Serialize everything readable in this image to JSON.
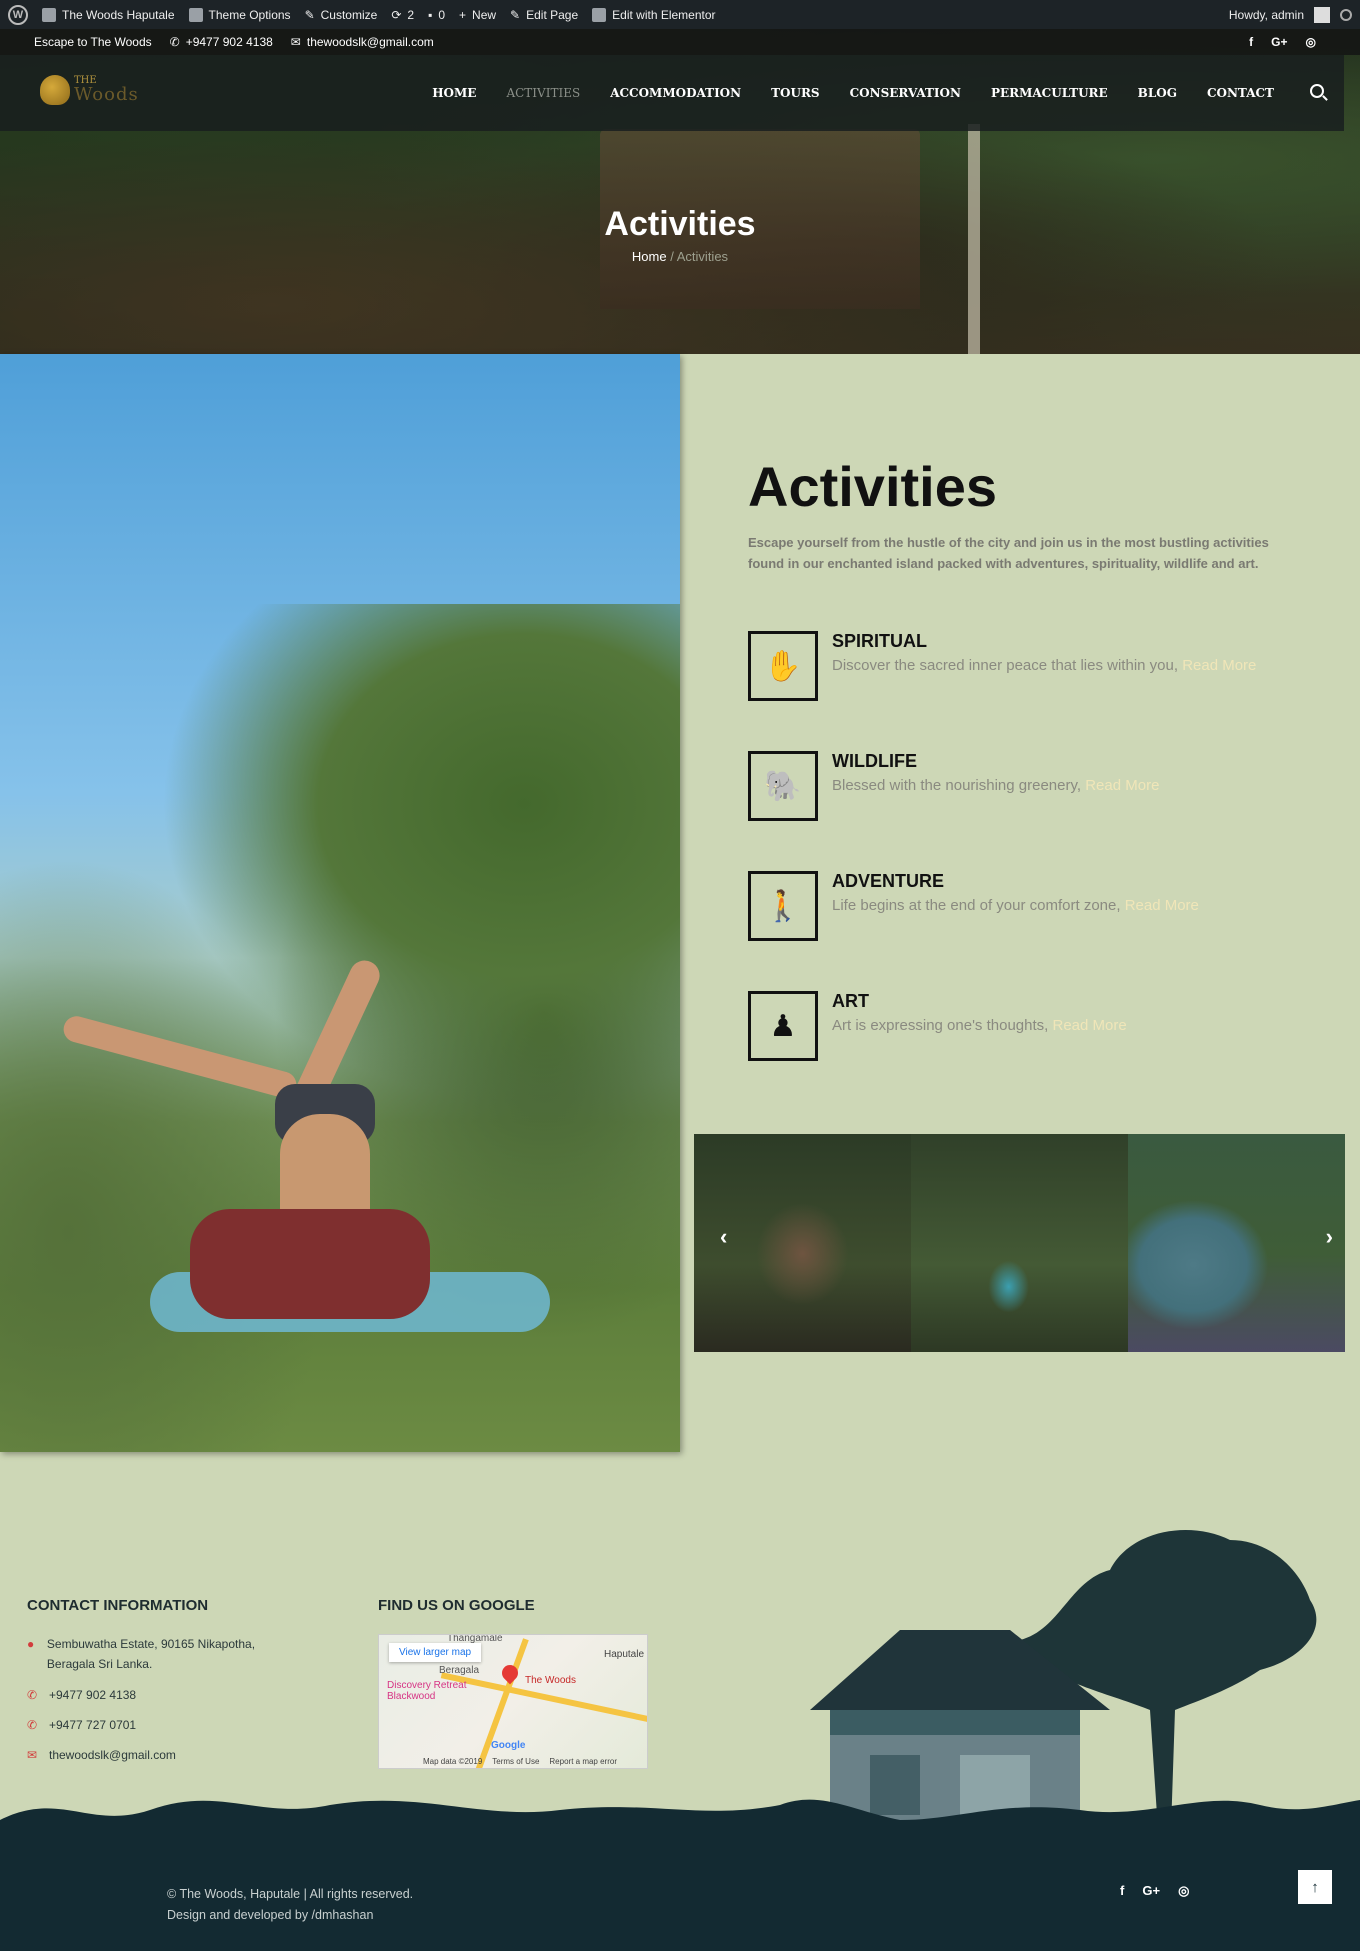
{
  "admin_bar": {
    "site_name": "The Woods Haputale",
    "theme_options": "Theme Options",
    "customize": "Customize",
    "updates_count": "2",
    "comments_count": "0",
    "new_label": "New",
    "edit_page": "Edit Page",
    "edit_elementor": "Edit with Elementor",
    "howdy": "Howdy, admin"
  },
  "top_info": {
    "tagline": "Escape to The Woods",
    "phone": "+9477 902 4138",
    "email": "thewoodslk@gmail.com",
    "social": [
      "f",
      "G+",
      "◎"
    ]
  },
  "logo": {
    "line1": "THE",
    "line2": "Woods"
  },
  "nav": {
    "items": [
      "HOME",
      "ACTIVITIES",
      "ACCOMMODATION",
      "TOURS",
      "CONSERVATION",
      "PERMACULTURE",
      "BLOG",
      "CONTACT"
    ],
    "active": "ACTIVITIES"
  },
  "hero": {
    "title": "Activities",
    "crumb_home": "Home",
    "crumb_sep": "/",
    "crumb_current": "Activities"
  },
  "main": {
    "heading": "Activities",
    "intro": "Escape yourself from the hustle of the city and join us in the most bustling activities found in our enchanted island packed with adventures, spirituality, wildlife and art.",
    "activities": [
      {
        "name": "SPIRITUAL",
        "desc": "Discover the sacred inner peace that lies within you,",
        "more": "Read More",
        "icon": "hamsa-icon"
      },
      {
        "name": "WILDLIFE",
        "desc": "Blessed with the nourishing greenery,",
        "more": "Read More",
        "icon": "elephant-icon"
      },
      {
        "name": "ADVENTURE",
        "desc": "Life begins at the end of your comfort zone,",
        "more": "Read More",
        "icon": "hiker-icon"
      },
      {
        "name": "ART",
        "desc": "Art is expressing one's thoughts,",
        "more": "Read More",
        "icon": "statue-icon"
      }
    ]
  },
  "footer": {
    "contact_heading": "CONTACT INFORMATION",
    "address": "Sembuwatha Estate, 90165 Nikapotha, Beragala Sri Lanka.",
    "phone1": "+9477 902 4138",
    "phone2": "+9477 727 0701",
    "email": "thewoodslk@gmail.com",
    "map_heading": "FIND US ON GOOGLE",
    "map": {
      "view_larger": "View larger map",
      "label_woods": "The Woods",
      "label_haputale": "Haputale",
      "label_discovery": "Discovery Retreat Blackwood",
      "label_beragala": "Beragala",
      "label_thangamale": "Thangamale",
      "google": "Google",
      "map_data": "Map data ©2019",
      "terms": "Terms of Use",
      "report": "Report a map error"
    },
    "copyright": "© The Woods, Haputale | All rights reserved.",
    "credit": "Design and developed by /dmhashan",
    "social": [
      "f",
      "G+",
      "◎"
    ],
    "to_top": "↑"
  },
  "colors": {
    "page_bg": "#cdd7b6",
    "footer_dark": "#132a32",
    "read_more": "#f0e6b8",
    "accent_red": "#d23c3c"
  }
}
